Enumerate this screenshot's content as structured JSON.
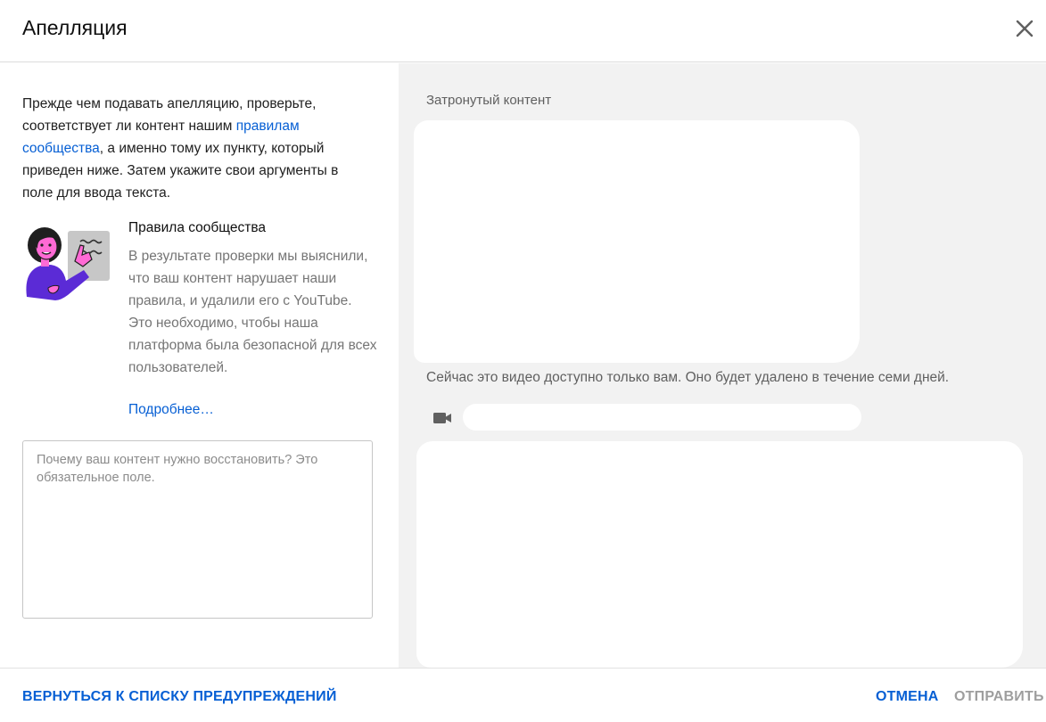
{
  "dialog": {
    "title": "Апелляция"
  },
  "left": {
    "intro_before": "Прежде чем подавать апелляцию, проверьте, соответствует ли контент нашим ",
    "intro_link": "правилам сообщества",
    "intro_after": ", а именно тому их пункту, который приведен ниже. Затем укажите свои аргументы в поле для ввода текста.",
    "rules_title": "Правила сообщества",
    "rules_text": "В результате проверки мы выяснили, что ваш контент нарушает наши правила, и удалили его с YouTube. Это необходимо, чтобы наша платформа была безопасной для всех пользователей.",
    "more_link": "Подробнее…",
    "textarea_placeholder": "Почему ваш контент нужно восстановить? Это обязательное поле.",
    "textarea_value": ""
  },
  "right": {
    "affected_label": "Затронутый контент",
    "status_text": "Сейчас это видео доступно только вам. Оно будет удалено в течение семи дней.",
    "video_icon": "video-camera-icon"
  },
  "footer": {
    "back_label": "ВЕРНУТЬСЯ К СПИСКУ ПРЕДУПРЕЖДЕНИЙ",
    "cancel_label": "ОТМЕНА",
    "submit_label": "ОТПРАВИТЬ"
  },
  "colors": {
    "link": "#065fd4",
    "panel_bg": "#f2f2f2",
    "disabled": "#9e9e9e"
  }
}
